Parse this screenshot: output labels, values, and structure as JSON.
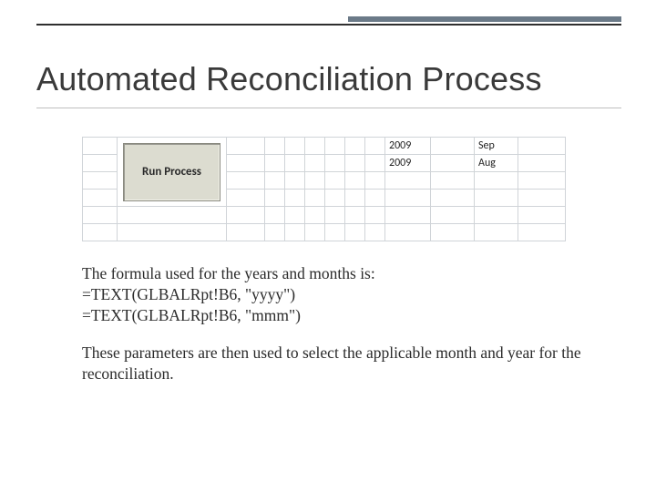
{
  "title": "Automated Reconciliation Process",
  "sheet": {
    "button_label": "Run Process",
    "rows": [
      {
        "year": "2009",
        "month": "Sep"
      },
      {
        "year": "2009",
        "month": "Aug"
      }
    ]
  },
  "paragraphs": {
    "p1_l1": "The formula used for the years and months is:",
    "p1_l2": "=TEXT(GLBALRpt!B6, \"yyyy\")",
    "p1_l3": "=TEXT(GLBALRpt!B6, \"mmm\")",
    "p2": "These parameters are then used to select the applicable month and year for the reconciliation."
  }
}
